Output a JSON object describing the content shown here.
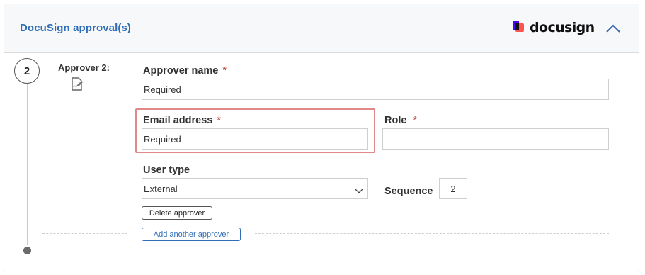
{
  "header": {
    "title": "DocuSign approval(s)",
    "brand_name": "docusign",
    "collapse_icon": "chevron-up-icon"
  },
  "step": {
    "number": "2",
    "approver_label": "Approver 2:",
    "icon": "signature-document-icon"
  },
  "form": {
    "approver_name": {
      "label": "Approver name",
      "required_mark": "*",
      "value": "Required"
    },
    "email": {
      "label": "Email address",
      "required_mark": "*",
      "value": "Required"
    },
    "role": {
      "label": "Role",
      "required_mark": "*",
      "value": ""
    },
    "user_type": {
      "label": "User type",
      "selected": "External"
    },
    "sequence": {
      "label": "Sequence",
      "value": "2"
    }
  },
  "buttons": {
    "delete": "Delete approver",
    "add": "Add another approver"
  },
  "colors": {
    "accent": "#2f6db5",
    "required": "#c0392b",
    "highlight": "#e0898a"
  }
}
